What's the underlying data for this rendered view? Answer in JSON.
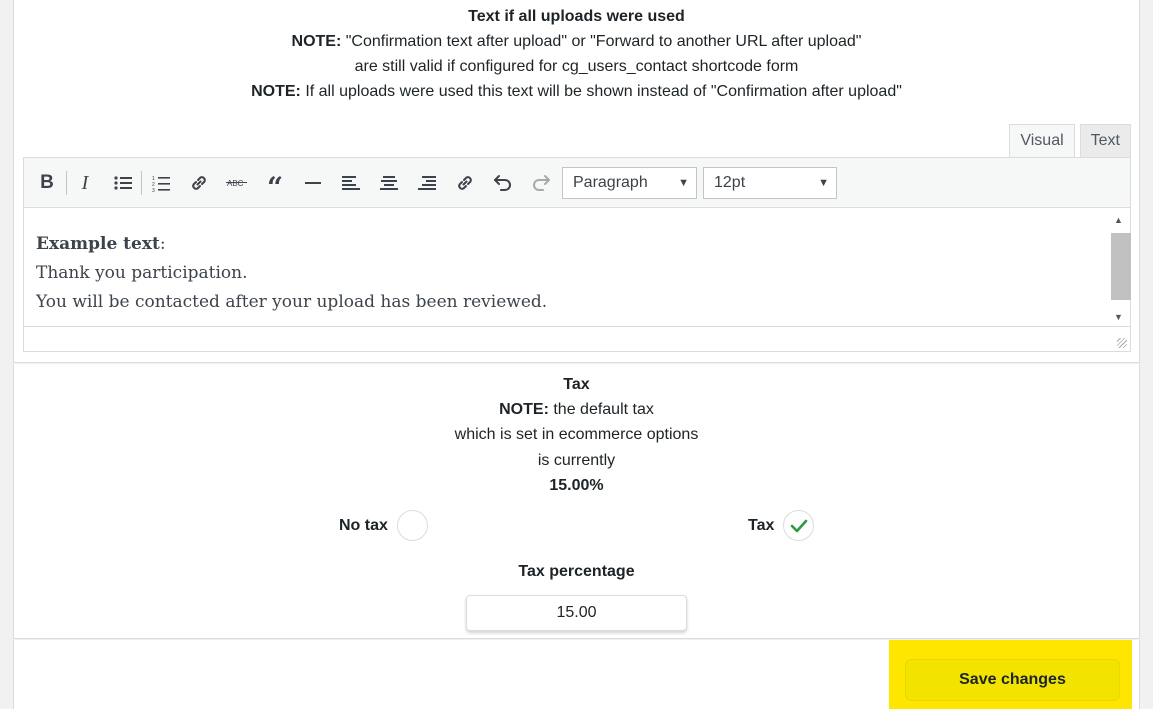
{
  "upload_section": {
    "title": "Text if all uploads were used",
    "note1_label": "NOTE:",
    "note1_text": " \"Confirmation text after upload\" or \"Forward to another URL after upload\"",
    "note1_line2": "are still valid if configured for cg_users_contact shortcode form",
    "note2_label": "NOTE:",
    "note2_text": " If all uploads were used this text will be shown instead of \"Confirmation after upload\""
  },
  "editor": {
    "tabs": [
      {
        "label": "Visual",
        "active": true
      },
      {
        "label": "Text",
        "active": false
      }
    ],
    "toolbar": {
      "buttons": [
        "bold-icon",
        "italic-icon",
        "bullet-list-icon",
        "numbered-list-icon",
        "link-icon",
        "strikethrough-icon",
        "blockquote-icon",
        "horizontal-rule-icon",
        "align-left-icon",
        "align-center-icon",
        "align-right-icon",
        "unlink-icon",
        "undo-icon",
        "redo-icon"
      ],
      "format_select": "Paragraph",
      "size_select": "12pt"
    },
    "content": {
      "heading": "Example text",
      "heading_suffix": ":",
      "line1": "Thank you participation.",
      "line2": "You will be contacted after your upload has been reviewed."
    }
  },
  "tax_section": {
    "title": "Tax",
    "note_label": "NOTE:",
    "note_text": " the default tax",
    "line2": "which is set in ecommerce options",
    "line3": "is currently",
    "value": "15.00%",
    "options": [
      {
        "label": "No tax",
        "checked": false
      },
      {
        "label": "Tax",
        "checked": true
      }
    ],
    "percentage_label": "Tax percentage",
    "percentage_value": "15.00"
  },
  "save": {
    "label": "Save changes"
  },
  "colors": {
    "highlight": "#ffe600",
    "check": "#2e9a3e"
  }
}
